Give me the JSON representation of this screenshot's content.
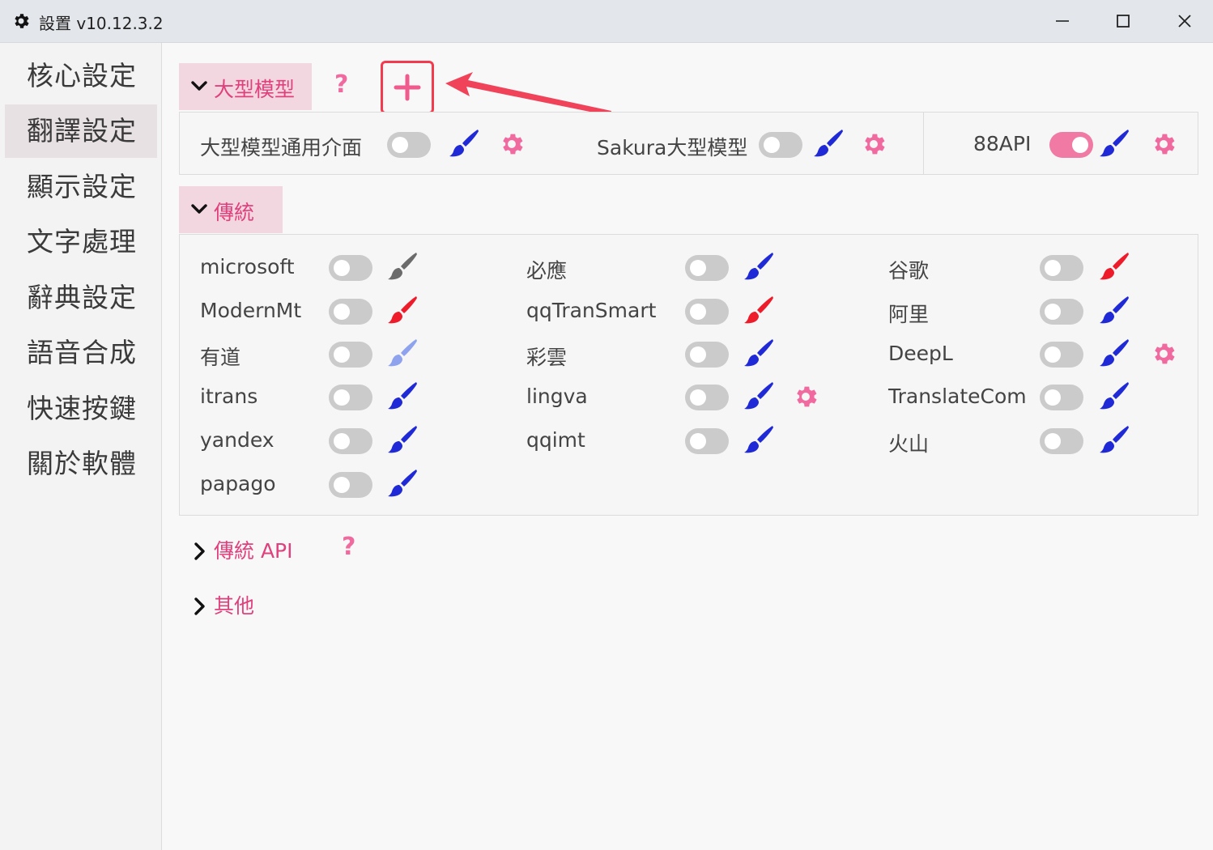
{
  "window": {
    "title": "設置 v10.12.3.2",
    "icons": {
      "app": "gear-icon",
      "minimize": "minimize-icon",
      "maximize": "maximize-icon",
      "close": "close-icon"
    }
  },
  "sidebar": {
    "items": [
      {
        "label": "核心設定",
        "active": false
      },
      {
        "label": "翻譯設定",
        "active": true
      },
      {
        "label": "顯示設定",
        "active": false
      },
      {
        "label": "文字處理",
        "active": false
      },
      {
        "label": "辭典設定",
        "active": false
      },
      {
        "label": "語音合成",
        "active": false
      },
      {
        "label": "快速按鍵",
        "active": false
      },
      {
        "label": "關於軟體",
        "active": false
      }
    ]
  },
  "sections": {
    "llm": {
      "title": "大型模型",
      "help": "?",
      "add_icon": "plus-icon",
      "items": [
        {
          "label": "大型模型通用介面",
          "on": false,
          "brush_color": "#1f2ad6",
          "has_gear": true
        },
        {
          "label": "Sakura大型模型",
          "on": false,
          "brush_color": "#1f2ad6",
          "has_gear": true
        },
        {
          "label": "88API",
          "on": true,
          "brush_color": "#1f2ad6",
          "has_gear": true
        }
      ]
    },
    "traditional": {
      "title": "傳統",
      "items": [
        {
          "label": "microsoft",
          "on": false,
          "brush_color": "#6b6b6b",
          "has_gear": false
        },
        {
          "label": "必應",
          "on": false,
          "brush_color": "#1f2ad6",
          "has_gear": false
        },
        {
          "label": "谷歌",
          "on": false,
          "brush_color": "#ee1c2a",
          "has_gear": false
        },
        {
          "label": "ModernMt",
          "on": false,
          "brush_color": "#ee1c2a",
          "has_gear": false
        },
        {
          "label": "qqTranSmart",
          "on": false,
          "brush_color": "#ee1c2a",
          "has_gear": false
        },
        {
          "label": "阿里",
          "on": false,
          "brush_color": "#1f2ad6",
          "has_gear": false
        },
        {
          "label": "有道",
          "on": false,
          "brush_color": "#8fa2ee",
          "has_gear": false
        },
        {
          "label": "彩雲",
          "on": false,
          "brush_color": "#1f2ad6",
          "has_gear": false
        },
        {
          "label": "DeepL",
          "on": false,
          "brush_color": "#1f2ad6",
          "has_gear": true
        },
        {
          "label": "itrans",
          "on": false,
          "brush_color": "#1f2ad6",
          "has_gear": false
        },
        {
          "label": "lingva",
          "on": false,
          "brush_color": "#1f2ad6",
          "has_gear": true
        },
        {
          "label": "TranslateCom",
          "on": false,
          "brush_color": "#1f2ad6",
          "has_gear": false
        },
        {
          "label": "yandex",
          "on": false,
          "brush_color": "#1f2ad6",
          "has_gear": false
        },
        {
          "label": "qqimt",
          "on": false,
          "brush_color": "#1f2ad6",
          "has_gear": false
        },
        {
          "label": "火山",
          "on": false,
          "brush_color": "#1f2ad6",
          "has_gear": false
        },
        {
          "label": "papago",
          "on": false,
          "brush_color": "#1f2ad6",
          "has_gear": false
        }
      ]
    },
    "traditional_api": {
      "title": "傳統 API",
      "help": "?"
    },
    "other": {
      "title": "其他"
    }
  },
  "colors": {
    "accent": "#e0407c",
    "gear": "#f06aa0",
    "toggle_on": "#f07aa4",
    "toggle_off": "#cbcbcb",
    "highlight_box": "#f23b4e"
  }
}
